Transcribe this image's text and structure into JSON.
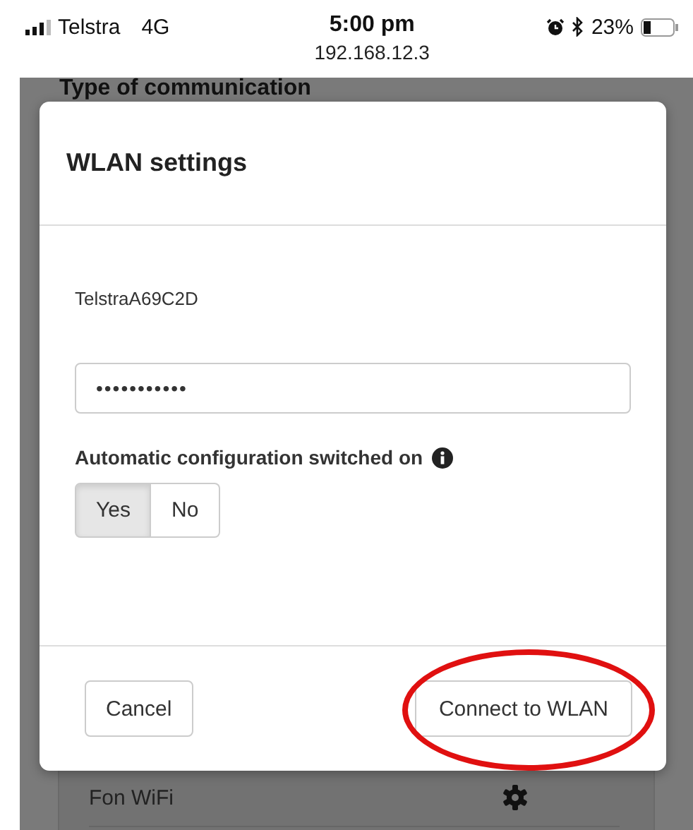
{
  "status_bar": {
    "carrier": "Telstra",
    "network": "4G",
    "time": "5:00 pm",
    "address": "192.168.12.3",
    "battery": "23%"
  },
  "background": {
    "heading": "Type of communication",
    "row_label": "Fon WiFi"
  },
  "dialog": {
    "title": "WLAN settings",
    "network_name": "TelstraA69C2D",
    "password": {
      "value": "•••••••••••"
    },
    "auto_config": {
      "label": "Automatic configuration switched on",
      "options": [
        {
          "label": "Yes",
          "selected": true
        },
        {
          "label": "No",
          "selected": false
        }
      ]
    },
    "buttons": [
      {
        "label": "Cancel",
        "kind": "cancel",
        "highlighted": false
      },
      {
        "label": "Connect to WLAN",
        "kind": "connect",
        "highlighted": true
      }
    ]
  }
}
